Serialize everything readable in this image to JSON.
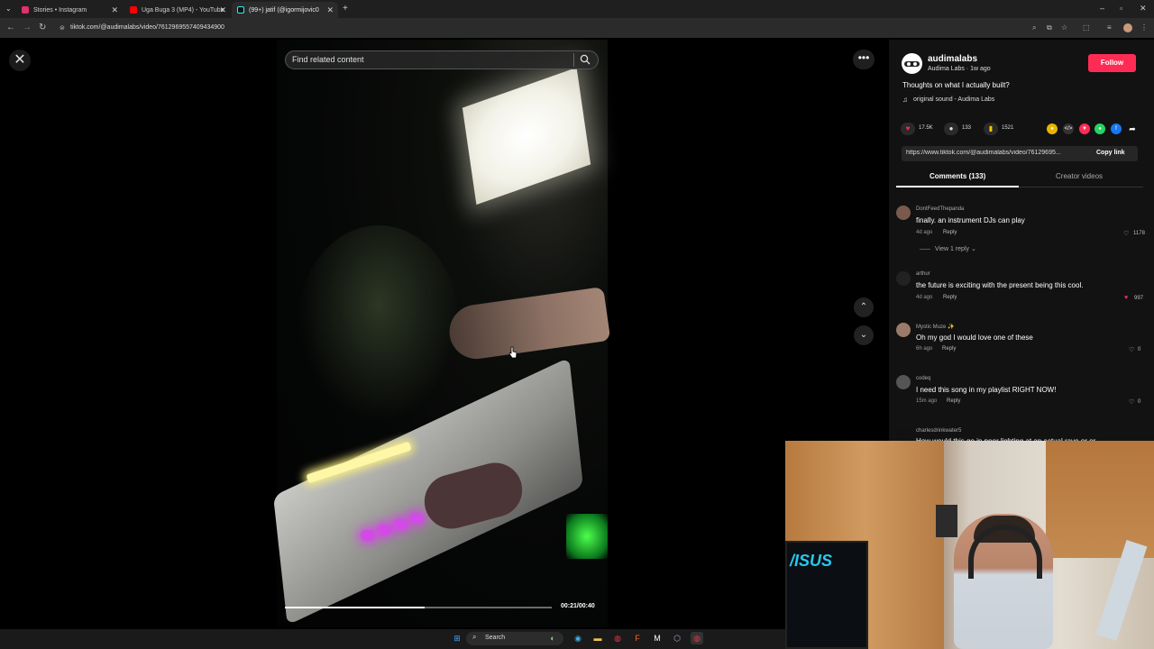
{
  "browser": {
    "tabs": [
      {
        "title": "Stories • Instagram",
        "active": false,
        "color": "#e1306c"
      },
      {
        "title": "Uga Buga 3 (MP4) - YouTube",
        "active": false,
        "color": "#ff0000"
      },
      {
        "title": "(99+) jatif (@igormijovic0",
        "active": true,
        "color": "#25f4ee"
      }
    ],
    "url": "tiktok.com/@audimalabs/video/7612969557409434900"
  },
  "video": {
    "search_placeholder": "Find related content",
    "time": "00:21/00:40",
    "progress": 0.525
  },
  "panel": {
    "author": "audimalabs",
    "author_sub": "Audima Labs · 1w ago",
    "follow_label": "Follow",
    "caption": "Thoughts on what I actually built?",
    "music": "original sound - Audima Labs",
    "likes": "17.5K",
    "comments_count": "133",
    "saves": "1521",
    "link": "https://www.tiktok.com/@audimalabs/video/76129695...",
    "copy_link": "Copy link",
    "tabs": [
      "Comments (133)",
      "Creator videos"
    ],
    "accent": "#fe2c55"
  },
  "comments": [
    {
      "user": "DontFeedThepanda",
      "text": "finally. an instrument DJs can play",
      "age": "4d ago",
      "reply": "Reply",
      "likes": "1178",
      "liked": false
    },
    {
      "user": "arthur",
      "text": "the future is exciting with the present being this cool.",
      "age": "4d ago",
      "reply": "Reply",
      "likes": "997",
      "liked": true
    },
    {
      "user": "Mystic Muze ✨",
      "text": "Oh my god I would love one of these",
      "age": "6h ago",
      "reply": "Reply",
      "likes": "0",
      "liked": false
    },
    {
      "user": "codeq",
      "text": "I need this song in my playlist RIGHT NOW!",
      "age": "15m ago",
      "reply": "Reply",
      "likes": "0",
      "liked": false
    },
    {
      "user": "charlesdrinkwater5",
      "text": "How would this go in poor lighting at an actual rave or or",
      "age": "",
      "reply": "",
      "likes": "",
      "liked": false
    }
  ],
  "view_reply": "View 1 reply",
  "taskbar": {
    "search_label": "Search"
  }
}
